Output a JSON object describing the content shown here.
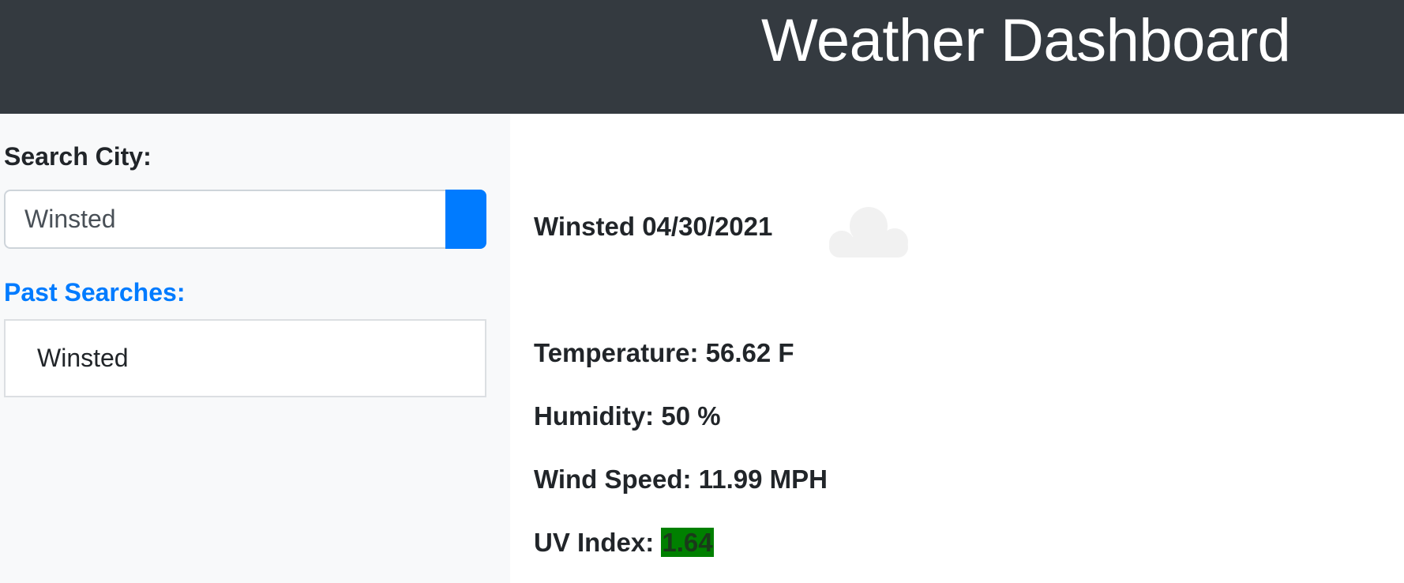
{
  "header": {
    "title": "Weather Dashboard"
  },
  "sidebar": {
    "search_label": "Search City:",
    "search_value": "Winsted",
    "search_button_color": "#007bff",
    "past_label": "Past Searches:",
    "past_searches": [
      "Winsted"
    ]
  },
  "current": {
    "city_date": "Winsted 04/30/2021",
    "icon": "cloud-icon",
    "temperature_label": "Temperature:",
    "temperature_value": "56.62 F",
    "humidity_label": "Humidity:",
    "humidity_value": "50 %",
    "wind_label": "Wind Speed:",
    "wind_value": "11.99 MPH",
    "uv_label": "UV Index:",
    "uv_value": "1.64",
    "uv_color": "#008000"
  },
  "colors": {
    "header_bg": "#343a40",
    "sidebar_bg": "#f8f9fa",
    "accent": "#007bff"
  }
}
